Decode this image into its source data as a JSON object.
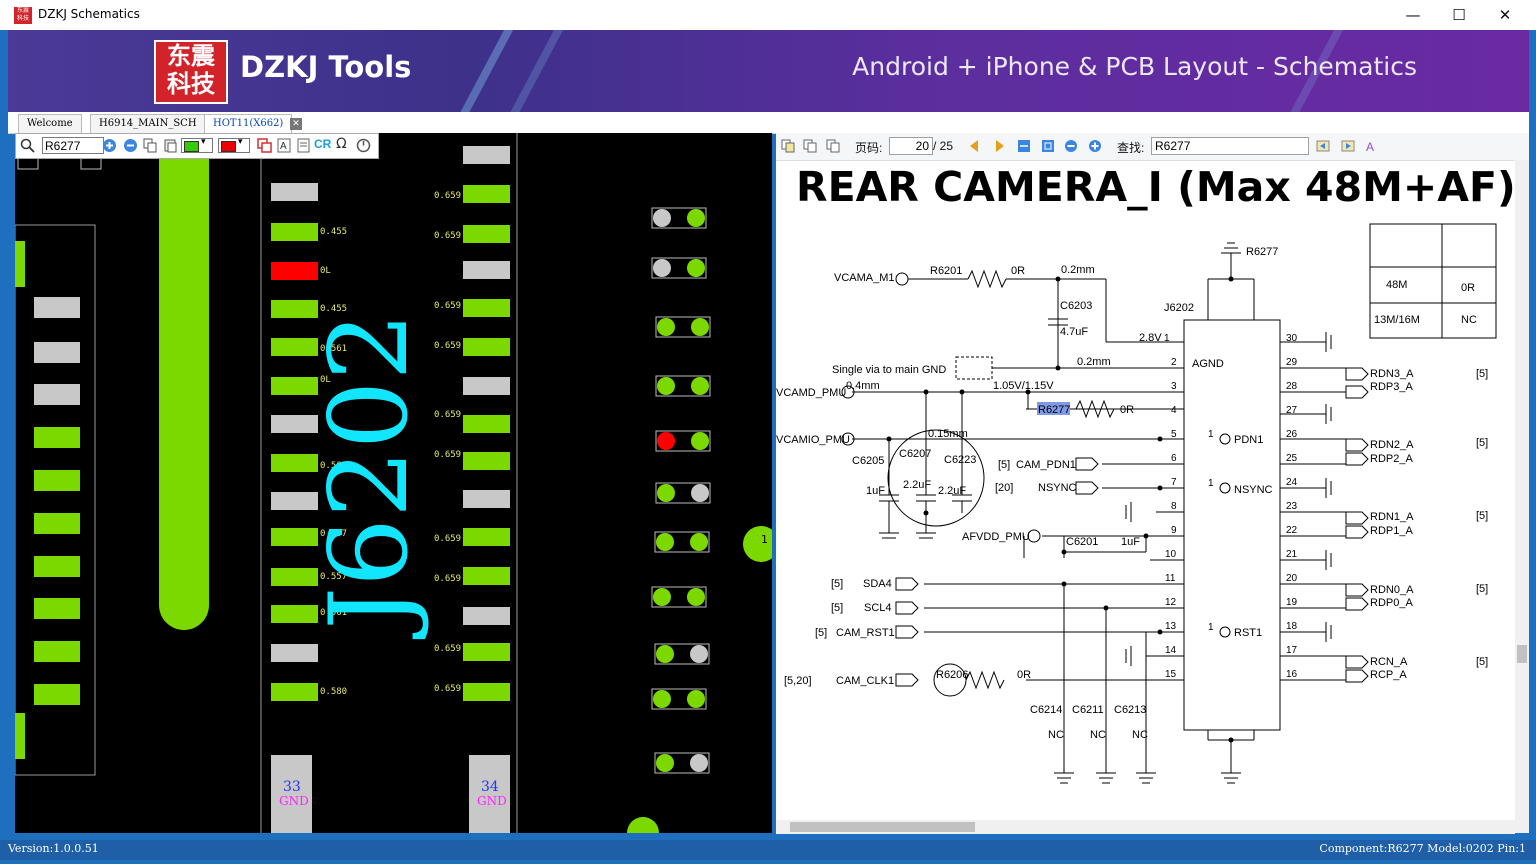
{
  "window": {
    "title": "DZKJ Schematics",
    "minimize": "—",
    "maximize": "☐",
    "close": "✕",
    "icon_text": "东震科技"
  },
  "banner": {
    "logo_chars": [
      "东",
      "震",
      "科",
      "技"
    ],
    "logo_text": "DZKJ Tools",
    "tagline": "Android + iPhone & PCB Layout - Schematics"
  },
  "tabs": [
    {
      "label": "Welcome"
    },
    {
      "label": "H6914_MAIN_SCH"
    },
    {
      "label": "HOT11(X662)"
    }
  ],
  "left_toolbar": {
    "search_value": "R6277",
    "cr_label": "CR",
    "ohm_label": "Ω"
  },
  "board": {
    "component_label": "J6202",
    "pin_labels": [
      {
        "num": "33",
        "net": "GND"
      },
      {
        "num": "34",
        "net": "GND"
      }
    ],
    "left_col_values": [
      "0.455",
      "0L",
      "0.455",
      "0.561",
      "0L",
      "",
      "0.561",
      "0.557",
      "0.557",
      "0.561",
      "",
      "0.580"
    ],
    "right_col_values": [
      "0.659",
      "0.659",
      "",
      "0.659",
      "0.659",
      "",
      "0.659",
      "0.659",
      "",
      "0.659",
      "0.659",
      "",
      "0.659",
      "0.659"
    ],
    "marker_text": "1"
  },
  "right_toolbar": {
    "page_label": "页码:",
    "page_current": "20",
    "page_total": "/ 25",
    "find_label": "查找:",
    "find_value": "R6277"
  },
  "schematic": {
    "title": "REAR CAMERA_I (Max 48M+AF)",
    "connector": "J6202",
    "table": {
      "header": [
        "",
        "R6277"
      ],
      "rows": [
        [
          "48M",
          "0R"
        ],
        [
          "13M/16M",
          "NC"
        ]
      ]
    },
    "left_nets": [
      "VCAMA_M1",
      "VCAMD_PMU",
      "VCAMIO_PMU",
      "CAM_PDN1",
      "NSYNC",
      "AFVDD_PMU",
      "SDA4",
      "SCL4",
      "CAM_RST1",
      "CAM_CLK1"
    ],
    "left_refs": [
      "[5]",
      "[20]",
      "[5]",
      "[5]",
      "[5]",
      "[5,20]"
    ],
    "components": [
      "R6201",
      "0R",
      "0.2mm",
      "C6203",
      "4.7uF",
      "2.8V",
      "0.2mm",
      "Single via to main GND",
      "0.4mm",
      "1.05V/1.15V",
      "R6277",
      "0R",
      "0.15mm",
      "C6205",
      "C6207",
      "C6223",
      "1uF",
      "2.2uF",
      "2.2uF",
      "C6201",
      "1uF",
      "R6206",
      "0R",
      "C6214",
      "C6211",
      "C6213",
      "NC",
      "NC",
      "NC"
    ],
    "connector_inner": [
      "AGND",
      "PDN1",
      "NSYNC",
      "RST1"
    ],
    "right_nets": [
      {
        "a": "RDN3_A",
        "b": "RDP3_A",
        "ref": "[5]"
      },
      {
        "a": "RDN2_A",
        "b": "RDP2_A",
        "ref": "[5]"
      },
      {
        "a": "RDN1_A",
        "b": "RDP1_A",
        "ref": "[5]"
      },
      {
        "a": "RDN0_A",
        "b": "RDP0_A",
        "ref": "[5]"
      },
      {
        "a": "RCN_A",
        "b": "RCP_A",
        "ref": "[5]"
      }
    ]
  },
  "status": {
    "version": "Version:1.0.0.51",
    "component": "Component:R6277 Model:0202 Pin:1"
  }
}
